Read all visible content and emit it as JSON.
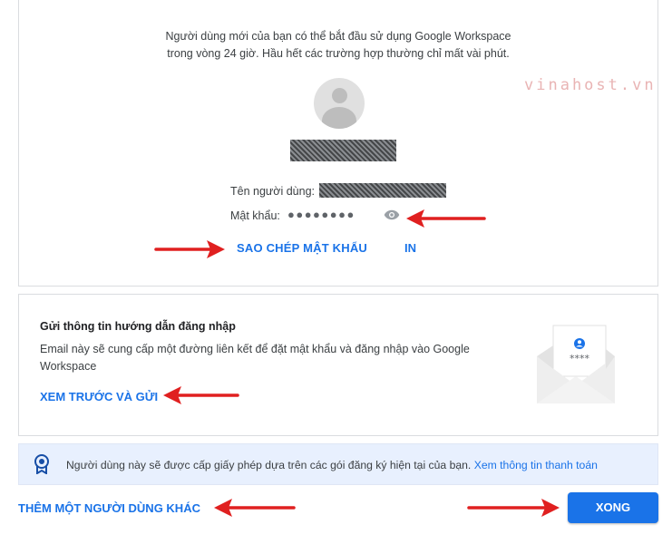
{
  "account_card": {
    "intro_line1": "Người dùng mới của bạn có thể bắt đầu sử dụng Google Workspace",
    "intro_line2": "trong vòng 24 giờ. Hầu hết các trường hợp thường chỉ mất vài phút.",
    "username_label": "Tên người dùng:",
    "password_label": "Mật khẩu:",
    "password_mask": "●●●●●●●●",
    "copy_password_label": "SAO CHÉP MẬT KHẨU",
    "print_label": "IN"
  },
  "watermark": "vinahost.vn",
  "signin_card": {
    "title": "Gửi thông tin hướng dẫn đăng nhập",
    "description": "Email này sẽ cung cấp một đường liên kết để đặt mật khẩu và đăng nhập vào Google Workspace",
    "preview_send_label": "XEM TRƯỚC VÀ GỬI",
    "envelope_mask": "****"
  },
  "license_banner": {
    "text": "Người dùng này sẽ được cấp giấy phép dựa trên các gói đăng ký hiện tại của bạn.",
    "link": "Xem thông tin thanh toán"
  },
  "footer": {
    "add_another_label": "THÊM MỘT NGƯỜI DÙNG KHÁC",
    "done_label": "XONG"
  },
  "colors": {
    "accent": "#1a73e8",
    "annotation_arrow": "#e02020",
    "banner_bg": "#e8f0fe"
  },
  "icons": [
    "avatar-placeholder-icon",
    "visibility-eye-icon",
    "envelope-icon",
    "license-ribbon-icon"
  ]
}
